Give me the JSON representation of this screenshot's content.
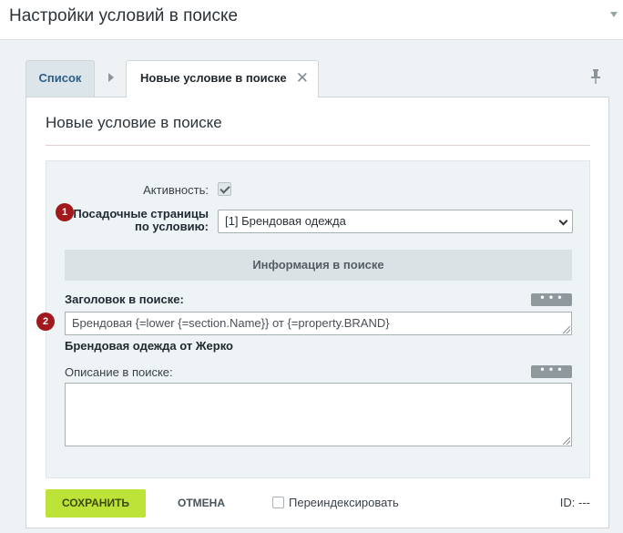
{
  "page": {
    "title": "Настройки условий в поиске"
  },
  "tabs": {
    "list": "Список",
    "active": "Новые условие в поиске",
    "close": "✕"
  },
  "panel": {
    "title": "Новые условие в поиске"
  },
  "form": {
    "active_label": "Активность:",
    "active_checked": true,
    "landing_label_line1": "Посадочные страницы",
    "landing_label_line2": "по условию:",
    "landing_value": "[1] Брендовая одежда",
    "section_title": "Информация в поиске",
    "heading_label": "Заголовок в поиске:",
    "heading_value": "Брендовая {=lower {=section.Name}} от {=property.BRAND}",
    "heading_preview": "Брендовая одежда от Жерко",
    "description_label": "Описание в поиске:",
    "description_value": "",
    "dots_label": "• • •"
  },
  "badges": {
    "one": "1",
    "two": "2"
  },
  "footer": {
    "save": "СОХРАНИТЬ",
    "cancel": "ОТМЕНА",
    "reindex": "Переиндексировать",
    "reindex_checked": false,
    "id": "ID: ---"
  },
  "colors": {
    "save_button": "#bde339",
    "badge": "#a1191d",
    "section_bar": "#dbe2e5"
  }
}
